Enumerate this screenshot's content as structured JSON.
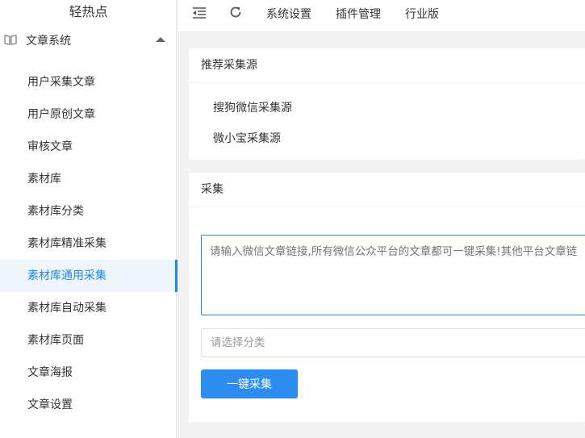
{
  "app": {
    "logo_text": "轻热点"
  },
  "sidebar": {
    "group": {
      "label": "文章系统",
      "icon": "book-icon",
      "expanded": true
    },
    "items": [
      {
        "label": "用户采集文章"
      },
      {
        "label": "用户原创文章"
      },
      {
        "label": "审核文章"
      },
      {
        "label": "素材库"
      },
      {
        "label": "素材库分类"
      },
      {
        "label": "素材库精准采集"
      },
      {
        "label": "素材库通用采集",
        "active": true
      },
      {
        "label": "素材库自动采集"
      },
      {
        "label": "素材库页面"
      },
      {
        "label": "文章海报"
      },
      {
        "label": "文章设置"
      }
    ]
  },
  "topbar": {
    "nav": [
      "系统设置",
      "插件管理",
      "行业版"
    ]
  },
  "recommend": {
    "title": "推荐采集源",
    "sources": [
      "搜狗微信采集源",
      "微小宝采集源"
    ]
  },
  "collect": {
    "title": "采集",
    "textarea_placeholder": "请输入微信文章链接,所有微信公众平台的文章都可一键采集!其他平台文章链",
    "select_placeholder": "请选择分类",
    "button_label": "一键采集"
  },
  "colors": {
    "accent": "#1e88e5",
    "button": "#2d8cf0",
    "active_bg": "#eef5fd"
  }
}
